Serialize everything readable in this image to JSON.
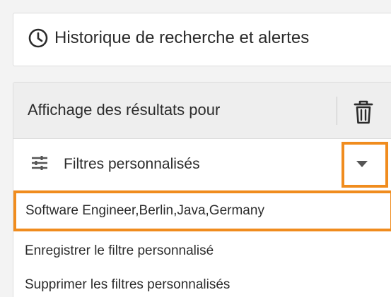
{
  "history": {
    "icon": "clock-icon",
    "label": "Historique de recherche et alertes"
  },
  "results": {
    "title": "Affichage des résultats pour",
    "delete_icon": "trash-icon"
  },
  "filters": {
    "icon": "sliders-icon",
    "label": "Filtres personnalisés",
    "toggle_icon": "caret-down-icon"
  },
  "menu": {
    "saved_filter": "Software Engineer,Berlin,Java,Germany",
    "save_label": "Enregistrer le filtre personnalisé",
    "delete_label": "Supprimer les filtres personnalisés"
  },
  "colors": {
    "highlight": "#f08c1e",
    "header_bg": "#eeeeee"
  }
}
